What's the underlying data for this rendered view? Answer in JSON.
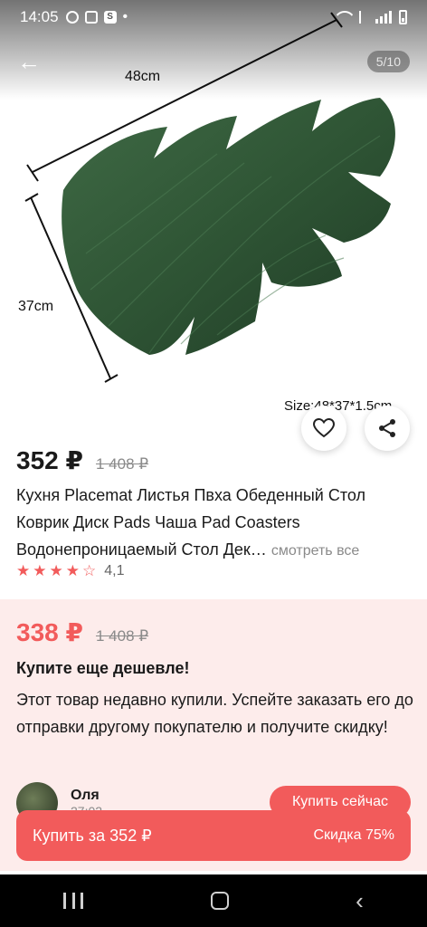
{
  "status_bar": {
    "time": "14:05"
  },
  "gallery": {
    "page_counter": "5/10",
    "dimension_width": "48cm",
    "dimension_height": "37cm",
    "size_caption": "Size:48*37*1.5cm"
  },
  "product": {
    "price": "352 ₽",
    "old_price": "1 408 ₽",
    "title": "Кухня Placemat Листья Пвха Обеденный Стол Коврик Диск Pads Чаша Pad Coasters Водонепроницаемый Стол Дек…",
    "see_all": "смотреть все",
    "rating_value": "4,1",
    "rating": 4.1
  },
  "promo": {
    "price": "338 ₽",
    "old_price": "1 408 ₽",
    "title": "Купите еще дешевле!",
    "description": "Этот товар недавно купили. Успейте заказать его до отправки другому покупателю и получите скидку!",
    "buyer_name": "Оля",
    "buyer_time": "27:02",
    "buy_now_label": "Купить сейчас"
  },
  "buy_bar": {
    "label": "Купить за 352 ₽",
    "discount": "Скидка 75%"
  },
  "colors": {
    "accent": "#f25b5b",
    "promo_bg": "#fdeceb",
    "leaf": "#2f5535"
  }
}
